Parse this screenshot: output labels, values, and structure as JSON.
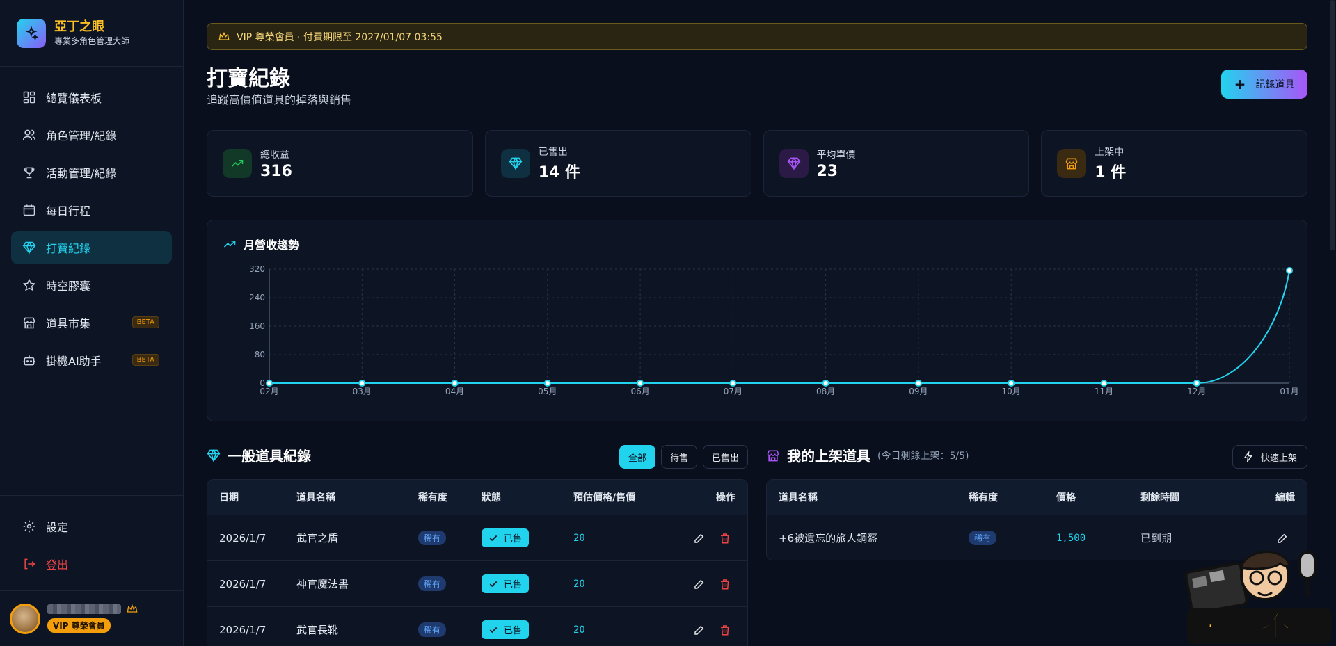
{
  "app": {
    "title": "亞丁之眼",
    "subtitle": "專業多角色管理大師"
  },
  "sidebar": {
    "items": [
      {
        "label": "總覽儀表板",
        "icon": "dashboard-icon"
      },
      {
        "label": "角色管理/紀錄",
        "icon": "users-icon"
      },
      {
        "label": "活動管理/紀錄",
        "icon": "trophy-icon"
      },
      {
        "label": "每日行程",
        "icon": "calendar-icon"
      },
      {
        "label": "打寶紀錄",
        "icon": "diamond-icon",
        "active": true
      },
      {
        "label": "時空膠囊",
        "icon": "star-icon"
      },
      {
        "label": "道具市集",
        "icon": "store-icon",
        "badge": "BETA"
      },
      {
        "label": "掛機AI助手",
        "icon": "bot-icon",
        "badge": "BETA"
      }
    ],
    "settings": "設定",
    "logout": "登出",
    "user": {
      "badge": "VIP 尊榮會員"
    }
  },
  "vip_banner": "VIP 尊榮會員 · 付費期限至 2027/01/07 03:55",
  "page": {
    "title": "打寶紀錄",
    "subtitle": "追蹤高價值道具的掉落與銷售",
    "record_button": "記錄道具"
  },
  "stats": [
    {
      "label": "總收益",
      "value": "316",
      "icon": "trending-up-icon",
      "color": "#22c55e"
    },
    {
      "label": "已售出",
      "value": "14 件",
      "icon": "diamond-icon",
      "color": "#22d3ee"
    },
    {
      "label": "平均單價",
      "value": "23",
      "icon": "gem-icon",
      "color": "#a855f7"
    },
    {
      "label": "上架中",
      "value": "1 件",
      "icon": "store-icon",
      "color": "#f59e0b"
    }
  ],
  "chart_title": "月營收趨勢",
  "chart_data": {
    "type": "line",
    "categories": [
      "02月",
      "03月",
      "04月",
      "05月",
      "06月",
      "07月",
      "08月",
      "09月",
      "10月",
      "11月",
      "12月",
      "01月"
    ],
    "values": [
      0,
      0,
      0,
      0,
      0,
      0,
      0,
      0,
      0,
      0,
      0,
      316
    ],
    "yticks": [
      0,
      80,
      160,
      240,
      320
    ],
    "ylim": [
      0,
      320
    ],
    "color": "#22d3ee",
    "grid": true
  },
  "general": {
    "title": "一般道具紀錄",
    "filters": [
      "全部",
      "待售",
      "已售出"
    ],
    "columns": [
      "日期",
      "道具名稱",
      "稀有度",
      "狀態",
      "預估價格/售價",
      "操作"
    ],
    "rows": [
      {
        "date": "2026/1/7",
        "name": "武官之盾",
        "rarity": "稀有",
        "status": "已售",
        "price": "20"
      },
      {
        "date": "2026/1/7",
        "name": "神官魔法書",
        "rarity": "稀有",
        "status": "已售",
        "price": "20"
      },
      {
        "date": "2026/1/7",
        "name": "武官長靴",
        "rarity": "稀有",
        "status": "已售",
        "price": "20"
      }
    ]
  },
  "listings": {
    "title": "我的上架道具",
    "remaining": "(今日剩餘上架：5/5)",
    "quick_button": "快速上架",
    "columns": [
      "道具名稱",
      "稀有度",
      "價格",
      "剩餘時間",
      "編輯"
    ],
    "rows": [
      {
        "name": "+6被遺忘的旅人鋼盔",
        "rarity": "稀有",
        "price": "1,500",
        "remaining": "已到期"
      }
    ]
  },
  "watermark": "編董不雷"
}
